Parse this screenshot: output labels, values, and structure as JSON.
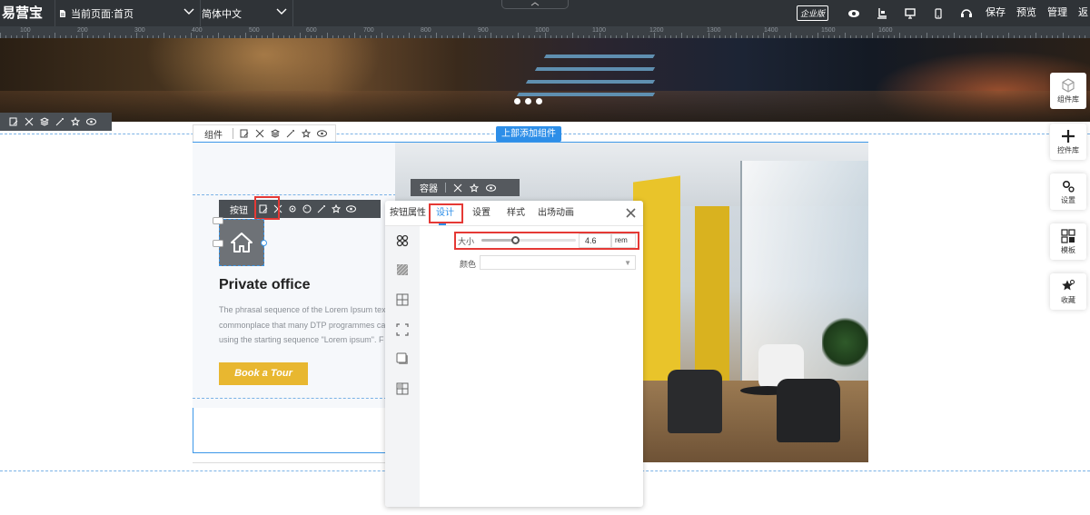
{
  "topbar": {
    "logo": "易营宝",
    "current_page": "当前页面:首页",
    "language": "简体中文",
    "edition_badge": "企业版",
    "save_label": "保存",
    "preview_label": "预览",
    "manage_label": "管理",
    "back_label": "返",
    "icons": [
      "eye-icon",
      "import-icon",
      "desktop-icon",
      "mobile-icon",
      "support-icon"
    ]
  },
  "ruler": {
    "labels": [
      "100",
      "200",
      "300",
      "400",
      "500",
      "600",
      "700",
      "800",
      "900",
      "1000",
      "1100",
      "1200",
      "1300",
      "1400",
      "1500",
      "1600"
    ]
  },
  "canvas": {
    "component_toolbar_label": "组件",
    "add_top_label": "上部添加组件",
    "container_toolbar_label": "容器",
    "button_toolbar_label": "按钮",
    "card": {
      "title": "Private office",
      "body_lines": [
        "The phrasal sequence of the Lorem Ipsum tex",
        "commonplace that many DTP programmes ca",
        "using the starting sequence \"Lorem ipsum\". F"
      ],
      "cta_label": "Book a Tour"
    }
  },
  "panel": {
    "tabs": [
      "按钮属性",
      "设计",
      "设置",
      "样式",
      "出场动画"
    ],
    "active_tab": "设计",
    "size_label": "大小",
    "size_value": "4.6",
    "size_unit": "rem",
    "size_slider_fraction": 0.37,
    "color_label": "颜色",
    "color_value": "",
    "side_icons": [
      "layout-icon",
      "texture-icon",
      "border-icon",
      "padding-icon",
      "shadow-icon",
      "grid-icon"
    ]
  },
  "dock": {
    "items": [
      {
        "label": "组件库",
        "icon": "cube-icon"
      },
      {
        "label": "控件库",
        "icon": "plus-icon"
      },
      {
        "label": "设置",
        "icon": "gears-icon"
      },
      {
        "label": "模板",
        "icon": "template-icon"
      },
      {
        "label": "收藏",
        "icon": "star-icon"
      }
    ]
  },
  "colors": {
    "topbar_bg": "#2f3337",
    "accent_blue": "#2d8ee8",
    "highlight_red": "#e53935",
    "cta_yellow": "#e8b730"
  }
}
